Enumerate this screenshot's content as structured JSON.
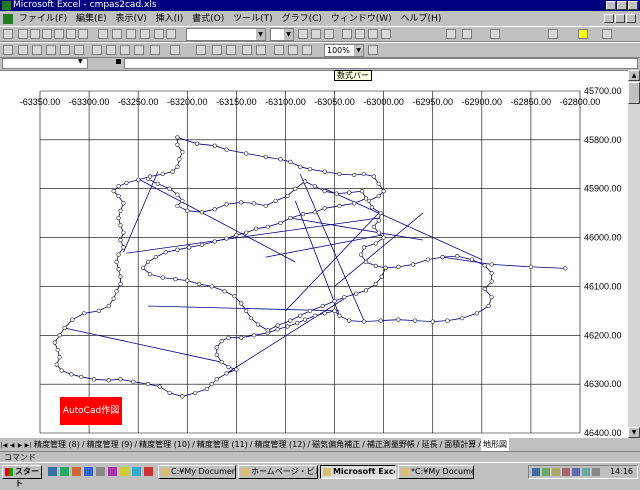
{
  "window": {
    "title": "Microsoft Excel - cmpas2cad.xls"
  },
  "menu": [
    "ファイル(F)",
    "編集(E)",
    "表示(V)",
    "挿入(I)",
    "書式(O)",
    "ツール(T)",
    "グラフ(C)",
    "ウィンドウ(W)",
    "ヘルプ(H)"
  ],
  "toolbar": {
    "zoom": "100%"
  },
  "formula_bar": {
    "tooltip": "数式バー"
  },
  "sheet_tabs": [
    "精度管理 (8)",
    "精度管理 (9)",
    "精度管理 (10)",
    "精度管理 (11)",
    "精度管理 (12)",
    "磁気偏角補正",
    "補正測量野帳",
    "延長",
    "面積計算",
    "地形図"
  ],
  "active_tab_index": 9,
  "status": "コマンド",
  "button": {
    "autocad": "AutoCad作図"
  },
  "taskbar": {
    "start": "スタート",
    "items": [
      "C:¥My Documents...",
      "ホームページ・ビルダ...",
      "Microsoft Exce...",
      "*C:¥My Document..."
    ],
    "active_index": 2,
    "clock": "14:16"
  },
  "chart_data": {
    "type": "scatter",
    "x_ticks": [
      "-63350.00",
      "-63300.00",
      "-63250.00",
      "-63200.00",
      "-63150.00",
      "-63100.00",
      "-63050.00",
      "-63000.00",
      "-62950.00",
      "-62900.00",
      "-62850.00",
      "-62800.00"
    ],
    "y_ticks": [
      "45700.00",
      "45800.00",
      "45900.00",
      "46000.00",
      "46100.00",
      "46200.00",
      "46300.00",
      "46400.00"
    ],
    "xlim": [
      -63350,
      -62800
    ],
    "ylim": [
      45700,
      46400
    ],
    "y_inverted": true,
    "grid": true,
    "line_color": "#00008b",
    "marker": "circle",
    "traverse": [
      [
        -63210,
        45795
      ],
      [
        -63190,
        45808
      ],
      [
        -63172,
        45812
      ],
      [
        -63160,
        45820
      ],
      [
        -63140,
        45828
      ],
      [
        -63120,
        45835
      ],
      [
        -63105,
        45840
      ],
      [
        -63095,
        45845
      ],
      [
        -63085,
        45855
      ],
      [
        -63075,
        45860
      ],
      [
        -63060,
        45865
      ],
      [
        -63045,
        45870
      ],
      [
        -63030,
        45872
      ],
      [
        -63020,
        45870
      ],
      [
        -63010,
        45875
      ],
      [
        -63005,
        45890
      ],
      [
        -63000,
        45905
      ],
      [
        -63005,
        45915
      ],
      [
        -63015,
        45925
      ],
      [
        -63012,
        45938
      ],
      [
        -63003,
        45950
      ],
      [
        -63005,
        45965
      ],
      [
        -63010,
        45978
      ],
      [
        -63005,
        45990
      ],
      [
        -63000,
        46000
      ],
      [
        -63008,
        46012
      ],
      [
        -63020,
        46020
      ],
      [
        -63023,
        46035
      ],
      [
        -63018,
        46050
      ],
      [
        -63008,
        46058
      ],
      [
        -62998,
        46062
      ],
      [
        -62985,
        46060
      ],
      [
        -62970,
        46055
      ],
      [
        -62955,
        46045
      ],
      [
        -62940,
        46040
      ],
      [
        -62925,
        46038
      ],
      [
        -62910,
        46045
      ],
      [
        -62897,
        46057
      ],
      [
        -62890,
        46073
      ],
      [
        -62890,
        46090
      ],
      [
        -62897,
        46105
      ],
      [
        -62890,
        46122
      ],
      [
        -62893,
        46140
      ],
      [
        -62905,
        46155
      ],
      [
        -62920,
        46165
      ],
      [
        -62935,
        46170
      ],
      [
        -62950,
        46172
      ],
      [
        -62968,
        46170
      ],
      [
        -62985,
        46168
      ],
      [
        -63003,
        46170
      ],
      [
        -63020,
        46172
      ],
      [
        -63035,
        46170
      ],
      [
        -63045,
        46160
      ],
      [
        -63050,
        46150
      ],
      [
        -63060,
        46155
      ],
      [
        -63070,
        46160
      ],
      [
        -63080,
        46168
      ],
      [
        -63088,
        46175
      ],
      [
        -63098,
        46182
      ],
      [
        -63108,
        46188
      ],
      [
        -63118,
        46195
      ],
      [
        -63132,
        46200
      ],
      [
        -63145,
        46205
      ],
      [
        -63158,
        46205
      ],
      [
        -63165,
        46212
      ],
      [
        -63170,
        46225
      ],
      [
        -63170,
        46240
      ],
      [
        -63165,
        46255
      ],
      [
        -63158,
        46265
      ],
      [
        -63150,
        46270
      ],
      [
        -63160,
        46278
      ],
      [
        -63170,
        46290
      ],
      [
        -63175,
        46300
      ],
      [
        -63180,
        46310
      ],
      [
        -63192,
        46318
      ],
      [
        -63205,
        46325
      ],
      [
        -63218,
        46318
      ],
      [
        -63228,
        46305
      ],
      [
        -63240,
        46300
      ],
      [
        -63255,
        46295
      ],
      [
        -63268,
        46290
      ],
      [
        -63280,
        46292
      ],
      [
        -63295,
        46290
      ],
      [
        -63308,
        46285
      ],
      [
        -63318,
        46280
      ],
      [
        -63328,
        46272
      ],
      [
        -63333,
        46260
      ],
      [
        -63330,
        46245
      ],
      [
        -63332,
        46230
      ],
      [
        -63335,
        46215
      ],
      [
        -63330,
        46200
      ],
      [
        -63325,
        46185
      ],
      [
        -63317,
        46168
      ],
      [
        -63305,
        46155
      ],
      [
        -63290,
        46150
      ],
      [
        -63280,
        46140
      ],
      [
        -63275,
        46125
      ],
      [
        -63272,
        46110
      ],
      [
        -63268,
        46095
      ],
      [
        -63268,
        46080
      ],
      [
        -63270,
        46065
      ],
      [
        -63272,
        46050
      ],
      [
        -63270,
        46035
      ],
      [
        -63265,
        46020
      ],
      [
        -63268,
        46005
      ],
      [
        -63265,
        45990
      ],
      [
        -63268,
        45975
      ],
      [
        -63270,
        45960
      ],
      [
        -63268,
        45945
      ],
      [
        -63265,
        45930
      ],
      [
        -63270,
        45915
      ],
      [
        -63275,
        45905
      ],
      [
        -63270,
        45895
      ],
      [
        -63262,
        45888
      ],
      [
        -63250,
        45882
      ],
      [
        -63238,
        45875
      ],
      [
        -63225,
        45870
      ],
      [
        -63215,
        45865
      ],
      [
        -63210,
        45855
      ],
      [
        -63208,
        45840
      ],
      [
        -63205,
        45825
      ],
      [
        -63210,
        45810
      ],
      [
        -63210,
        45795
      ]
    ],
    "traverse_markers": true,
    "inner_path": [
      [
        -63240,
        45880
      ],
      [
        -63230,
        45890
      ],
      [
        -63218,
        45900
      ],
      [
        -63210,
        45912
      ],
      [
        -63205,
        45925
      ],
      [
        -63210,
        45935
      ],
      [
        -63200,
        45945
      ],
      [
        -63185,
        45948
      ],
      [
        -63172,
        45942
      ],
      [
        -63160,
        45932
      ],
      [
        -63145,
        45928
      ],
      [
        -63132,
        45930
      ],
      [
        -63120,
        45935
      ],
      [
        -63110,
        45925
      ],
      [
        -63098,
        45915
      ],
      [
        -63090,
        45900
      ],
      [
        -63080,
        45885
      ],
      [
        -63070,
        45895
      ],
      [
        -63060,
        45905
      ],
      [
        -63048,
        45910
      ],
      [
        -63035,
        45908
      ],
      [
        -63022,
        45905
      ],
      [
        -63018,
        45920
      ],
      [
        -63030,
        45930
      ],
      [
        -63045,
        45935
      ],
      [
        -63060,
        45940
      ],
      [
        -63070,
        45948
      ],
      [
        -63082,
        45952
      ],
      [
        -63095,
        45960
      ],
      [
        -63105,
        45970
      ],
      [
        -63118,
        45978
      ],
      [
        -63130,
        45982
      ],
      [
        -63140,
        45990
      ],
      [
        -63150,
        45995
      ],
      [
        -63160,
        46002
      ],
      [
        -63172,
        46008
      ],
      [
        -63185,
        46015
      ],
      [
        -63198,
        46020
      ],
      [
        -63210,
        46025
      ],
      [
        -63222,
        46030
      ],
      [
        -63232,
        46040
      ],
      [
        -63240,
        46050
      ],
      [
        -63245,
        46062
      ],
      [
        -63238,
        46075
      ],
      [
        -63225,
        46082
      ],
      [
        -63212,
        46085
      ],
      [
        -63200,
        46088
      ],
      [
        -63188,
        46095
      ],
      [
        -63175,
        46100
      ],
      [
        -63162,
        46110
      ],
      [
        -63152,
        46120
      ],
      [
        -63145,
        46135
      ],
      [
        -63140,
        46150
      ],
      [
        -63135,
        46165
      ],
      [
        -63128,
        46178
      ],
      [
        -63118,
        46190
      ],
      [
        -63108,
        46180
      ],
      [
        -63095,
        46170
      ],
      [
        -63085,
        46160
      ],
      [
        -63075,
        46150
      ],
      [
        -63062,
        46140
      ],
      [
        -63050,
        46130
      ],
      [
        -63040,
        46122
      ],
      [
        -63028,
        46115
      ],
      [
        -63018,
        46108
      ],
      [
        -63008,
        46095
      ],
      [
        -63002,
        46080
      ],
      [
        -62998,
        46062
      ]
    ],
    "inner_markers": true,
    "tie_lines": [
      [
        [
          -63265,
          46030
        ],
        [
          -63230,
          45865
        ]
      ],
      [
        [
          -63262,
          46032
        ],
        [
          -63005,
          45960
        ]
      ],
      [
        [
          -63120,
          46040
        ],
        [
          -63002,
          45995
        ]
      ],
      [
        [
          -63085,
          45870
        ],
        [
          -63020,
          46170
        ]
      ],
      [
        [
          -63090,
          45925
        ],
        [
          -63045,
          46160
        ]
      ],
      [
        [
          -63240,
          46140
        ],
        [
          -63045,
          46150
        ]
      ],
      [
        [
          -63160,
          46278
        ],
        [
          -63040,
          46125
        ]
      ],
      [
        [
          -63325,
          46185
        ],
        [
          -63165,
          46255
        ]
      ],
      [
        [
          -63250,
          45880
        ],
        [
          -63090,
          46050
        ]
      ],
      [
        [
          -63060,
          45900
        ],
        [
          -62900,
          46045
        ]
      ],
      [
        [
          -63005,
          45950
        ],
        [
          -63100,
          46150
        ]
      ],
      [
        [
          -62960,
          45950
        ],
        [
          -63050,
          46100
        ]
      ],
      [
        [
          -63095,
          45960
        ],
        [
          -62960,
          46005
        ]
      ]
    ],
    "tail_line": [
      [
        -62940,
        46040
      ],
      [
        -62890,
        46055
      ],
      [
        -62850,
        46060
      ],
      [
        -62815,
        46063
      ]
    ]
  }
}
